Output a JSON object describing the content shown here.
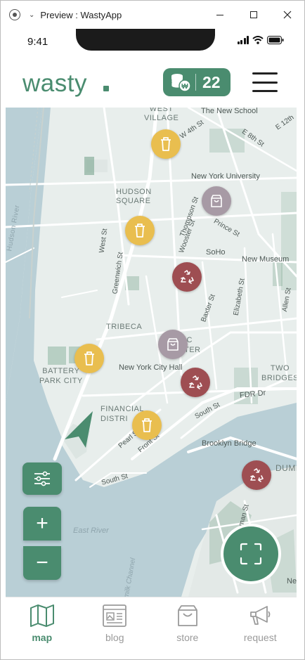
{
  "window": {
    "title": "Preview : WastyApp",
    "minimize": "—",
    "maximize": "☐",
    "close": "✕"
  },
  "status_bar": {
    "time": "9:41"
  },
  "header": {
    "logo": "wasty",
    "coin_count": "22"
  },
  "map": {
    "labels": {
      "west_village": "WEST\nVILLAGE",
      "new_school": "The New School",
      "nyu": "New York University",
      "hudson_square": "HUDSON\nSQUARE",
      "hudson_river": "Hudson River",
      "soho": "SoHo",
      "new_museum": "New Museum",
      "tribeca": "TRIBECA",
      "civic_center": "IC\nTER",
      "battery_park_city": "BATTERY\nPARK CITY",
      "nyc_hall": "New York City Hall",
      "two_bridges": "TWO\nBRIDGES",
      "financial_district": "FINANCIAL\nDISTRI",
      "fdr_dr": "FDR Dr",
      "brooklyn_bridge": "Brooklyn Bridge",
      "dumbo": "DUMB",
      "east_river": "East River",
      "buttermilk_channel": "milk Channel",
      "e12th": "E 12th",
      "w4th": "W 4th St",
      "e8th": "E 8th St",
      "thompson": "Thompson St",
      "prince": "Prince St",
      "greenwich": "Greenwich St",
      "west_st": "West St",
      "wooster": "Wooster St",
      "baxter": "Baxter St",
      "elizabeth": "Elizabeth St",
      "allen": "Allen St",
      "south_st": "South St",
      "south_st2": "South St",
      "pearl": "Pearl St",
      "front": "Front St",
      "furman": "Furman St",
      "ne": "Ne"
    },
    "markers": [
      {
        "type": "trash",
        "icon": "trash-icon"
      },
      {
        "type": "bag",
        "icon": "shopping-bag-icon"
      },
      {
        "type": "trash",
        "icon": "trash-icon"
      },
      {
        "type": "recycle",
        "icon": "recycle-icon"
      },
      {
        "type": "bag",
        "icon": "shopping-bag-icon"
      },
      {
        "type": "trash",
        "icon": "trash-icon"
      },
      {
        "type": "recycle",
        "icon": "recycle-icon"
      },
      {
        "type": "trash",
        "icon": "trash-icon"
      },
      {
        "type": "recycle",
        "icon": "recycle-icon"
      }
    ],
    "controls": {
      "zoom_in": "+",
      "zoom_out": "−"
    }
  },
  "tabs": [
    {
      "label": "map",
      "icon": "map-icon",
      "active": true
    },
    {
      "label": "blog",
      "icon": "blog-icon",
      "active": false
    },
    {
      "label": "store",
      "icon": "store-bag-icon",
      "active": false
    },
    {
      "label": "request",
      "icon": "megaphone-icon",
      "active": false
    }
  ],
  "colors": {
    "brand": "#4a8c6f",
    "trash": "#e9be4f",
    "bag": "#a79aa5",
    "recycle": "#9e4e52",
    "water": "#b9cfd6"
  }
}
